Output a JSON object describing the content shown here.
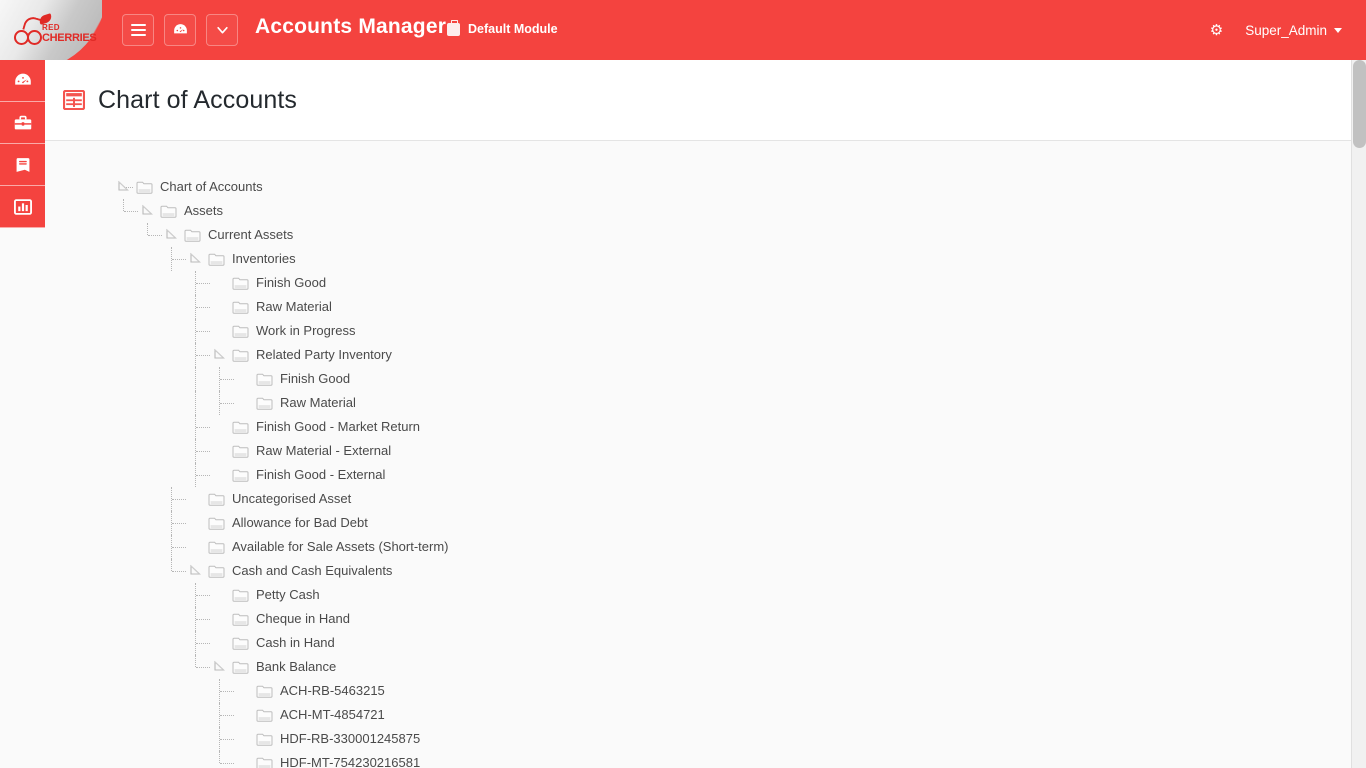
{
  "header": {
    "logo": {
      "line1": "RED",
      "line2": "CHERRIES",
      "alt": "Red Cherries logo"
    },
    "buttons": [
      {
        "name": "menu-toggle-button",
        "icon": "hamburger-icon"
      },
      {
        "name": "dashboard-button",
        "icon": "gauge-icon"
      },
      {
        "name": "more-options-button",
        "icon": "chevron-down-icon"
      }
    ],
    "app_title": "Accounts Manager",
    "module_label": "Default Module",
    "settings_icon": "gear-icon",
    "user_name": "Super_Admin",
    "accent_color": "#f4433f"
  },
  "sidebar": {
    "items": [
      {
        "name": "sidebar-item-dashboard",
        "icon": "gauge-icon"
      },
      {
        "name": "sidebar-item-toolbox",
        "icon": "briefcase-icon"
      },
      {
        "name": "sidebar-item-journal",
        "icon": "book-icon"
      },
      {
        "name": "sidebar-item-reports",
        "icon": "bar-chart-icon"
      }
    ]
  },
  "page": {
    "title": "Chart of Accounts",
    "title_icon": "table-grid-icon"
  },
  "tree": {
    "nodes": [
      {
        "label": "Chart of Accounts",
        "level": 0,
        "expandable": true,
        "expanded": true
      },
      {
        "label": "Assets",
        "level": 1,
        "expandable": true,
        "expanded": true
      },
      {
        "label": "Current Assets",
        "level": 2,
        "expandable": true,
        "expanded": true
      },
      {
        "label": "Inventories",
        "level": 3,
        "expandable": true,
        "expanded": true
      },
      {
        "label": "Finish Good",
        "level": 4,
        "expandable": false,
        "expanded": false
      },
      {
        "label": "Raw Material",
        "level": 4,
        "expandable": false,
        "expanded": false
      },
      {
        "label": "Work in Progress",
        "level": 4,
        "expandable": false,
        "expanded": false
      },
      {
        "label": "Related Party Inventory",
        "level": 4,
        "expandable": true,
        "expanded": true
      },
      {
        "label": "Finish Good",
        "level": 5,
        "expandable": false,
        "expanded": false
      },
      {
        "label": "Raw Material",
        "level": 5,
        "expandable": false,
        "expanded": false
      },
      {
        "label": "Finish Good - Market Return",
        "level": 4,
        "expandable": false,
        "expanded": false
      },
      {
        "label": "Raw Material - External",
        "level": 4,
        "expandable": false,
        "expanded": false
      },
      {
        "label": "Finish Good - External",
        "level": 4,
        "expandable": false,
        "expanded": false
      },
      {
        "label": "Uncategorised Asset",
        "level": 3,
        "expandable": false,
        "expanded": false
      },
      {
        "label": "Allowance for Bad Debt",
        "level": 3,
        "expandable": false,
        "expanded": false
      },
      {
        "label": "Available for Sale Assets (Short-term)",
        "level": 3,
        "expandable": false,
        "expanded": false
      },
      {
        "label": "Cash and Cash Equivalents",
        "level": 3,
        "expandable": true,
        "expanded": true
      },
      {
        "label": "Petty Cash",
        "level": 4,
        "expandable": false,
        "expanded": false
      },
      {
        "label": "Cheque in Hand",
        "level": 4,
        "expandable": false,
        "expanded": false
      },
      {
        "label": "Cash in Hand",
        "level": 4,
        "expandable": false,
        "expanded": false
      },
      {
        "label": "Bank Balance",
        "level": 4,
        "expandable": true,
        "expanded": true
      },
      {
        "label": "ACH-RB-5463215",
        "level": 5,
        "expandable": false,
        "expanded": false
      },
      {
        "label": "ACH-MT-4854721",
        "level": 5,
        "expandable": false,
        "expanded": false
      },
      {
        "label": "HDF-RB-330001245875",
        "level": 5,
        "expandable": false,
        "expanded": false
      },
      {
        "label": "HDF-MT-754230216581",
        "level": 5,
        "expandable": false,
        "expanded": false
      }
    ]
  },
  "scrollbar": {
    "name": "vertical-scrollbar",
    "thumb_top": 0
  }
}
